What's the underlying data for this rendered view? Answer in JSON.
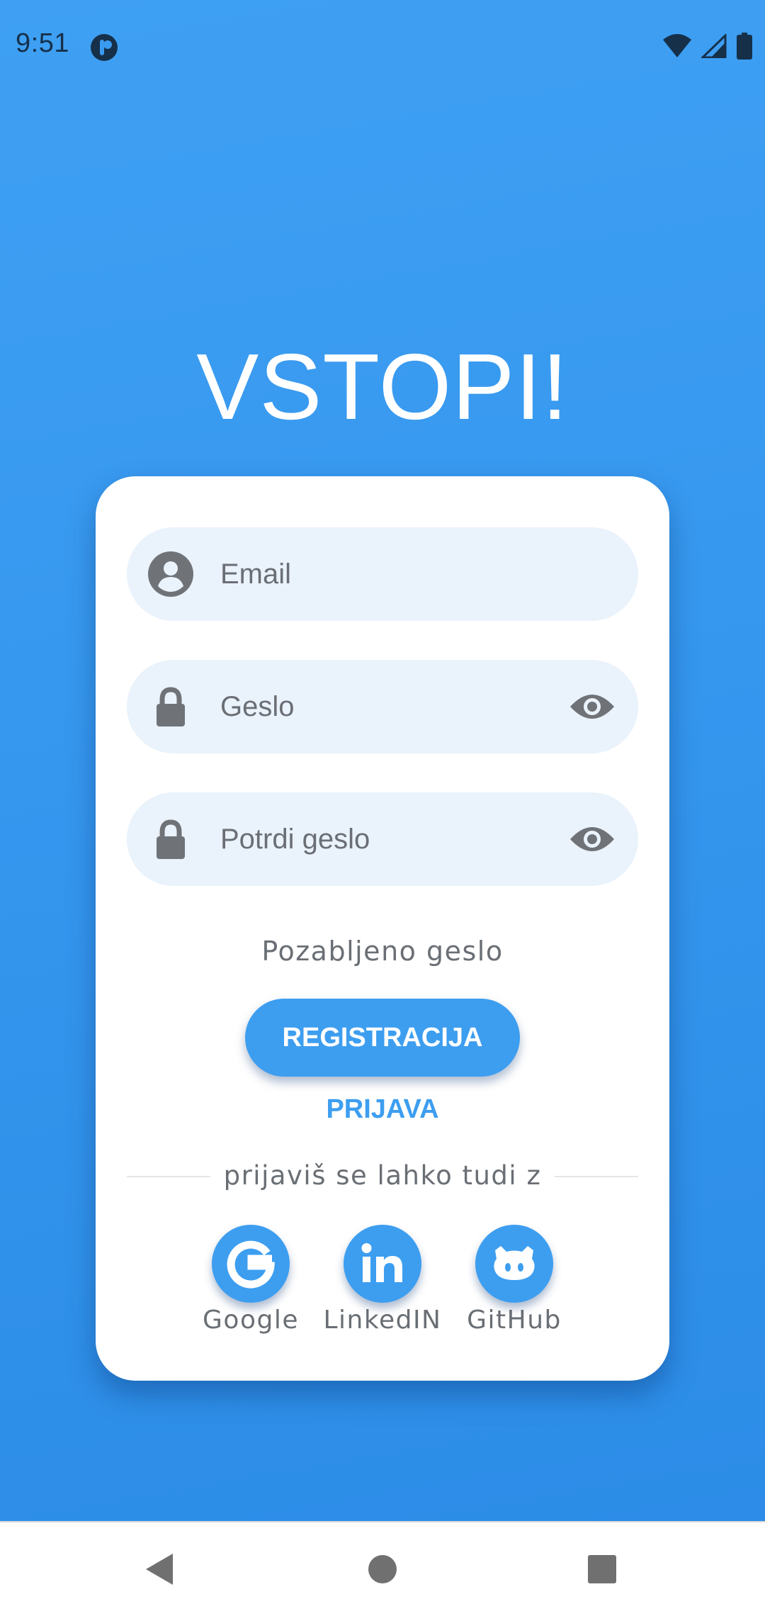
{
  "status_bar": {
    "time": "9:51",
    "icons": [
      "app-notification-icon",
      "wifi-icon",
      "cellular-signal-icon",
      "battery-icon"
    ]
  },
  "title": "VSTOPI!",
  "form": {
    "email_placeholder": "Email",
    "password_placeholder": "Geslo",
    "confirm_password_placeholder": "Potrdi geslo"
  },
  "forgot_password": "Pozabljeno geslo",
  "register_button": "REGISTRACIJA",
  "login_link": "PRIJAVA",
  "social_divider": "prijaviš se lahko tudi z",
  "social": [
    {
      "label": "Google",
      "icon": "google-icon"
    },
    {
      "label": "LinkedIN",
      "icon": "linkedin-icon"
    },
    {
      "label": "GitHub",
      "icon": "github-icon"
    }
  ],
  "nav": {
    "icons": [
      "back-icon",
      "home-icon",
      "recents-icon"
    ]
  },
  "colors": {
    "background": "#3597ee",
    "accent": "#3d9ef0",
    "field_bg": "#eaf2fb",
    "text_grey": "#6a6f75"
  }
}
